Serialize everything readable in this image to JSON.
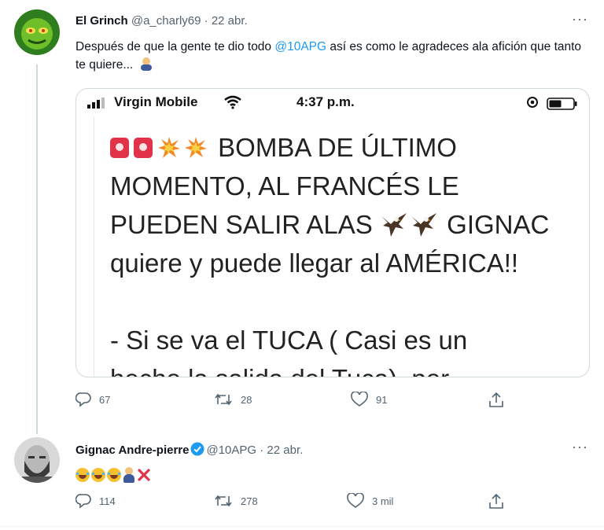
{
  "tweet1": {
    "display_name": "El Grinch",
    "handle": "@a_charly69",
    "separator": "·",
    "date": "22 abr.",
    "text_before": "Después de que la gente te dio todo ",
    "mention": "@10APG",
    "text_after": " así es como le agradeces ala afición que tanto te quiere...",
    "more_label": "···",
    "media": {
      "carrier": "Virgin Mobile",
      "time": "4:37 p.m.",
      "line1": "BOMBA DE ÚLTIMO",
      "line2": "MOMENTO, AL FRANCÉS LE",
      "line3a": "PUEDEN SALIR ALAS",
      "line3b": "GIGNAC",
      "line4": "quiere y puede llegar al AMÉRICA!!",
      "line5": "-  Si se va el TUCA ( Casi es un",
      "line6": "hecho la salida del Tuca), por"
    },
    "stats": {
      "replies": "67",
      "retweets": "28",
      "likes": "91"
    }
  },
  "tweet2": {
    "display_name": "Gignac Andre-pierre",
    "handle": "@10APG",
    "separator": "·",
    "date": "22 abr.",
    "more_label": "···",
    "stats": {
      "replies": "114",
      "retweets": "278",
      "likes": "3 mil"
    }
  },
  "colors": {
    "accent": "#1d9bf0",
    "text": "#0f1419",
    "muted": "#536471",
    "border": "#cfd9de",
    "verified": "#1d9bf0",
    "cross": "#e0334a"
  },
  "icons": [
    "reply-icon",
    "retweet-icon",
    "like-icon",
    "share-icon",
    "verified-icon",
    "wifi-icon",
    "battery-icon"
  ]
}
